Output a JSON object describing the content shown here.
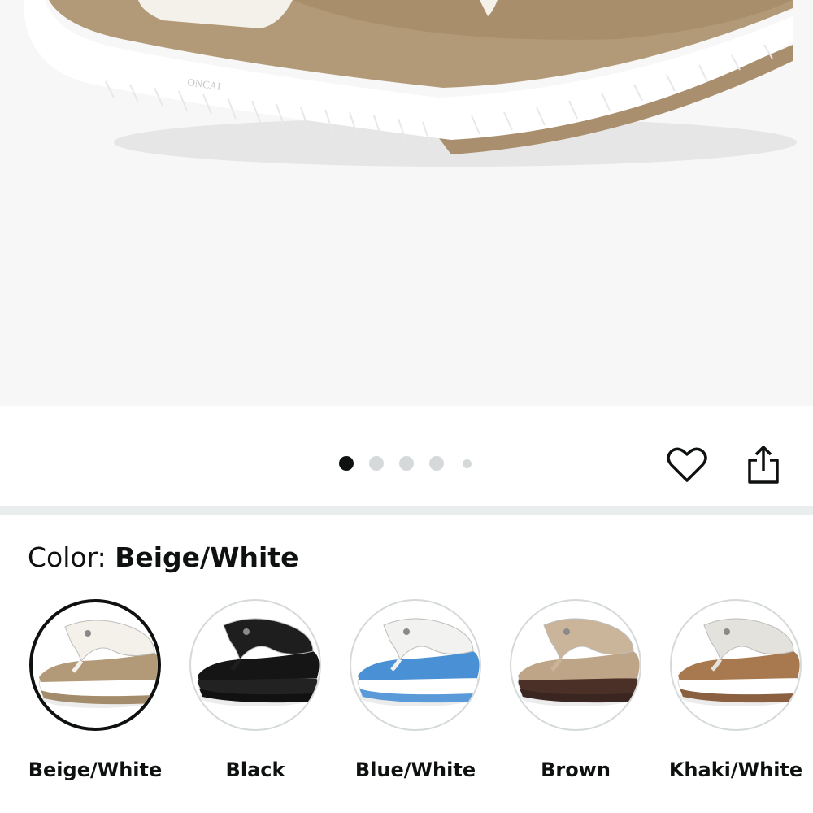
{
  "product_image": {
    "alt": "Beige/White flip-flop sandal close-up",
    "brand_mark": "ONCAI"
  },
  "carousel": {
    "total_dots": 5,
    "active_index": 0
  },
  "actions": {
    "wishlist_icon": "heart-icon",
    "share_icon": "share-icon"
  },
  "color_selector": {
    "label": "Color: ",
    "selected_value": "Beige/White",
    "options": [
      {
        "label": "Beige/White",
        "strap": "#f4f1ea",
        "footbed": "#b29a78",
        "sole": "#ffffff",
        "base": "#a38c6b"
      },
      {
        "label": "Black",
        "strap": "#1e1e1e",
        "footbed": "#151515",
        "sole": "#222222",
        "base": "#111111"
      },
      {
        "label": "Blue/White",
        "strap": "#f2f2f0",
        "footbed": "#4a90d4",
        "sole": "#ffffff",
        "base": "#5a9ad8"
      },
      {
        "label": "Brown",
        "strap": "#cbb59a",
        "footbed": "#bfa587",
        "sole": "#4a3026",
        "base": "#3a2520"
      },
      {
        "label": "Khaki/White",
        "strap": "#e4e2dc",
        "footbed": "#a8794f",
        "sole": "#ffffff",
        "base": "#8a6040"
      }
    ]
  }
}
